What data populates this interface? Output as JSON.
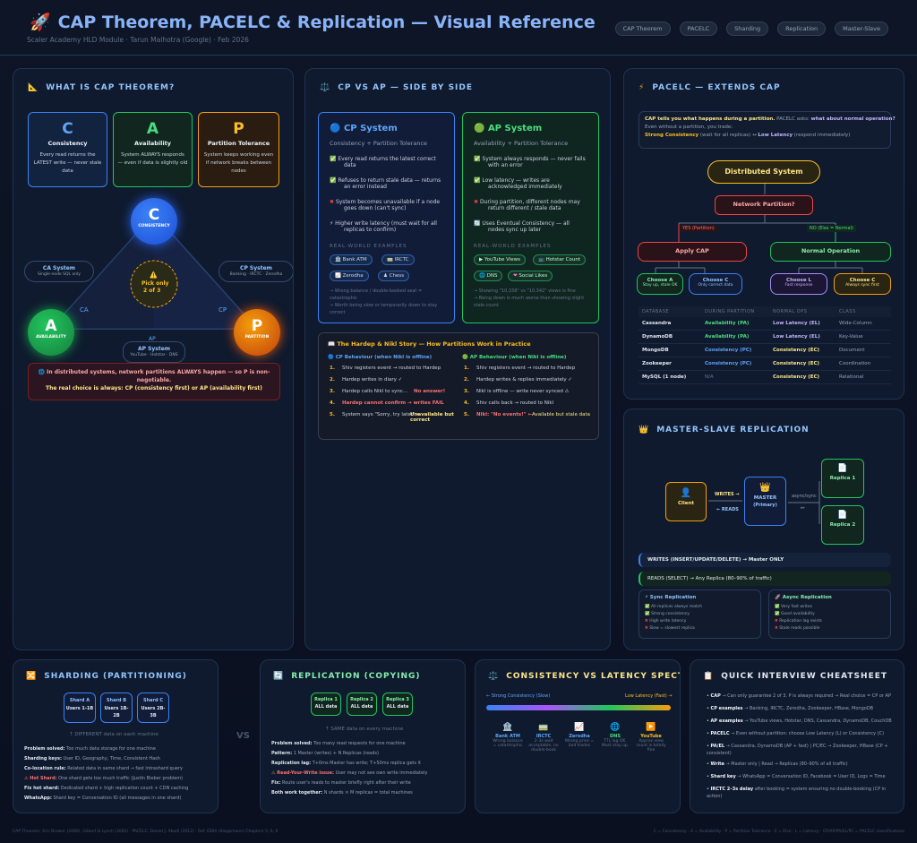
{
  "header": {
    "title": "CAP Theorem, PACELC & Replication — Visual Reference",
    "subtitle": "Scaler Academy HLD Module · Tarun Malhotra (Google) · Feb 2026",
    "tags": [
      "CAP Theorem",
      "PACELC",
      "Sharding",
      "Replication",
      "Master-Slave"
    ]
  },
  "cap": {
    "heading": "WHAT IS CAP THEOREM?",
    "c": {
      "letter": "C",
      "name": "Consistency",
      "d1": "Every read returns the",
      "d2": "LATEST write — never stale",
      "d3": "data"
    },
    "a": {
      "letter": "A",
      "name": "Availability",
      "d1": "System ALWAYS responds",
      "d2": "— even if data is slightly old"
    },
    "p": {
      "letter": "P",
      "name": "Partition Tolerance",
      "d1": "System keeps working even",
      "d2": "if network breaks between",
      "d3": "nodes"
    },
    "tri": {
      "c_label": "CONSISTENCY",
      "a_label": "AVAILABILITY",
      "p_label": "PARTITION",
      "center1": "Pick only",
      "center2": "2 of 3",
      "ca_edge": "CA",
      "cp_edge": "CP",
      "ap_edge": "AP"
    },
    "ca_sys": {
      "name": "CA System",
      "sub": "Single-node SQL only"
    },
    "cp_sys": {
      "name": "CP System",
      "sub": "Banking · IRCTC · Zerodha"
    },
    "ap_sys": {
      "name": "AP System",
      "sub": "YouTube · Hotstar · DNS"
    },
    "note1": "In distributed systems, network partitions ALWAYS happen — so P is non-",
    "note2": "negotiable.",
    "note3": "The real choice is always: CP (consistency first) or AP (availability first)"
  },
  "cpap": {
    "heading": "CP VS AP — SIDE BY SIDE",
    "cp": {
      "title": "CP System",
      "sub": "Consistency + Partition Tolerance",
      "items": [
        [
          "Every read returns the latest correct",
          "data"
        ],
        [
          "Refuses to return stale data — returns",
          "an error instead"
        ],
        [
          "System becomes unavailable if a node",
          "goes down (can't sync)"
        ],
        [
          "Higher write latency (must wait for all",
          "replicas to confirm)"
        ]
      ],
      "examples_label": "REAL-WORLD EXAMPLES",
      "examples": [
        "Bank ATM",
        "IRCTC",
        "Zerodha",
        "Chess"
      ],
      "foot": [
        "→ Wrong balance / double-booked seat =",
        "catastrophic",
        "→ Worth being slow or temporarily down to stay",
        "correct"
      ]
    },
    "ap": {
      "title": "AP System",
      "sub": "Availability + Partition Tolerance",
      "items": [
        [
          "System always responds — never fails",
          "with an error"
        ],
        [
          "Low latency — writes are",
          "acknowledged immediately"
        ],
        [
          "During partition, different nodes may",
          "return different / stale data"
        ],
        [
          "Uses Eventual Consistency — all",
          "nodes sync up later"
        ]
      ],
      "examples_label": "REAL-WORLD EXAMPLES",
      "examples": [
        "YouTube Views",
        "Hotstar Count",
        "DNS",
        "Social Likes"
      ],
      "foot": [
        "→ Showing \"10,338\" vs \"10,342\" views is fine",
        "→ Being down is much worse than showing slight",
        "stale count"
      ]
    },
    "story": {
      "title": "The Hardep & Nikl Story — How Partitions Work in Practice",
      "cp_head": "CP Behaviour (when Nikl is offline)",
      "ap_head": "AP Behaviour (when Nikl is offline)",
      "cp_rows": [
        [
          "1.",
          "Shiv registers event → routed to Hardep",
          ""
        ],
        [
          "2.",
          "Hardep writes in diary ✓",
          ""
        ],
        [
          "3.",
          "Hardep calls Nikl to sync...",
          "No answer!"
        ],
        [
          "4.",
          "Hardep cannot confirm → writes FAIL",
          ""
        ],
        [
          "5.",
          "System says \"Sorry, try later\" ←",
          "Unavailable but correct"
        ]
      ],
      "ap_rows": [
        [
          "1.",
          "Shiv registers event → routed to Hardep",
          ""
        ],
        [
          "2.",
          "Hardep writes & replies immediately ✓",
          ""
        ],
        [
          "3.",
          "Nikl is offline — write never synced ⚠",
          ""
        ],
        [
          "4.",
          "Shiv calls back → routed to Nikl",
          ""
        ],
        [
          "5.",
          "Nikl: \"No events!\" ←",
          "Available but stale data"
        ]
      ]
    }
  },
  "pacelc": {
    "heading": "PACELC — EXTENDS CAP",
    "intro1a": "CAP tells you what happens during a partition.",
    "intro1b": " PACELC asks: ",
    "intro1c": "what about normal operation?",
    "intro2": "Even without a partition, you trade:",
    "intro3a": "Strong Consistency",
    "intro3b": " (wait for all replicas) ",
    "intro3c": "Low Latency",
    "intro3d": " (respond immediately)",
    "ds": "Distributed System",
    "np": "Network Partition?",
    "yes": "YES (Partition)",
    "no": "NO (Else = Normal)",
    "apply_cap": "Apply CAP",
    "normal_ops": "Normal Operation",
    "ch": [
      {
        "t": "Choose A",
        "s": "Stay up, stale OK"
      },
      {
        "t": "Choose C",
        "s": "Only correct data"
      },
      {
        "t": "Choose L",
        "s": "Fast response"
      },
      {
        "t": "Choose C",
        "s": "Always sync first"
      }
    ],
    "table": {
      "cols": [
        "DATABASE",
        "DURING PARTITION",
        "NORMAL OPS",
        "CLASS"
      ],
      "rows": [
        [
          "Cassandra",
          "Availability (PA)",
          "Low Latency (EL)",
          "Wide-Column"
        ],
        [
          "DynamoDB",
          "Availability (PA)",
          "Low Latency (EL)",
          "Key-Value"
        ],
        [
          "MongoDB",
          "Consistency (PC)",
          "Consistency (EC)",
          "Document"
        ],
        [
          "Zookeeper",
          "Consistency (PC)",
          "Consistency (EC)",
          "Coordination"
        ],
        [
          "MySQL (1 node)",
          "N/A",
          "Consistency (EC)",
          "Relational"
        ]
      ]
    }
  },
  "ms": {
    "heading": "MASTER-SLAVE REPLICATION",
    "client": "Client",
    "writes": "WRITES →",
    "reads": "← READS",
    "master1": "MASTER",
    "master2": "(Primary)",
    "async": "async/sync",
    "r1": "Replica 1",
    "r2": "Replica 2",
    "w_bar": "WRITES (INSERT/UPDATE/DELETE) → Master ONLY",
    "r_bar": "READS (SELECT) → Any Replica (80–90% of traffic)",
    "sync": {
      "title": "Sync Replication",
      "items": [
        "All replicas always match",
        "Strong consistency",
        "High write latency",
        "Slow = slowest replica"
      ]
    },
    "async_r": {
      "title": "Async Replication",
      "items": [
        "Very fast writes",
        "Good availability",
        "Replication lag exists",
        "Stale reads possible"
      ]
    }
  },
  "shard": {
    "heading": "SHARDING (PARTITIONING)",
    "shards": [
      [
        "Shard A",
        "Users 1-1B"
      ],
      [
        "Shard B",
        "Users 1B-2B"
      ],
      [
        "Shard C",
        "Users 2B-3B"
      ]
    ],
    "caption": "↑ DIFFERENT data on each machine",
    "rows": [
      [
        "Problem solved:",
        "Too much data storage for one machine"
      ],
      [
        "Sharding keys:",
        "User ID, Geography, Time, Consistent Hash"
      ],
      [
        "Co-location rule:",
        "Related data in same shard → fast intrashard query"
      ],
      [
        "⚠ Hot Shard:",
        "One shard gets too much traffic (Justin Bieber problem)"
      ],
      [
        "Fix hot shard:",
        "Dedicated shard + high replication count + CDN caching"
      ],
      [
        "WhatsApp:",
        "Shard key = Conversation ID (all messages in one shard)"
      ]
    ]
  },
  "vs": "VS",
  "repl": {
    "heading": "REPLICATION (COPYING)",
    "reps": [
      [
        "Replica 1",
        "ALL data"
      ],
      [
        "Replica 2",
        "ALL data"
      ],
      [
        "Replica 3",
        "ALL data"
      ]
    ],
    "caption": "↑ SAME data on every machine",
    "rows": [
      [
        "Problem solved:",
        "Too many read requests for one machine"
      ],
      [
        "Pattern:",
        "1 Master (writes) + N Replicas (reads)"
      ],
      [
        "Replication lag:",
        "T+0ms Master has write; T+50ms replica gets it"
      ],
      [
        "⚠ Read-Your-Write issue:",
        "User may not see own write immediately"
      ],
      [
        "Fix:",
        "Route user's reads to master briefly right after their write"
      ],
      [
        "Both work together:",
        "N shards × M replicas = total machines"
      ]
    ]
  },
  "spec": {
    "heading": "CONSISTENCY VS LATENCY SPECTRUM",
    "left": "← Strong Consistency (Slow)",
    "right": "Low Latency (Fast) →",
    "items": [
      [
        "Bank ATM",
        "Wrong balance",
        "= catastrophic"
      ],
      [
        "IRCTC",
        "2–3s wait",
        "acceptable, no",
        "double-book"
      ],
      [
        "Zerodha",
        "Wrong price =",
        "bad trades"
      ],
      [
        "DNS",
        "TTL lag OK.",
        "Must stay up."
      ],
      [
        "YouTube",
        "Approx view",
        "count is totally",
        "fine"
      ]
    ]
  },
  "cheat": {
    "heading": "QUICK INTERVIEW CHEATSHEET",
    "rows": [
      [
        "CAP",
        "→ Can only guarantee 2 of 3. P is always required → Real choice = CP or AP"
      ],
      [
        "CP examples",
        "→ Banking, IRCTC, Zerodha, Zookeeper, HBase, MongoDB"
      ],
      [
        "AP examples",
        "→ YouTube views, Hotstar, DNS, Cassandra, DynamoDB, CouchDB"
      ],
      [
        "PACELC",
        "→ Even without partition: choose Low Latency (L) or Consistency (C)"
      ],
      [
        "PA/EL",
        "→ Cassandra, DynamoDB (AP + fast)  |  PC/EC → Zookeeper, HBase (CP + consistent)"
      ],
      [
        "Write",
        "→ Master only  |  Read → Replicas (80–90% of all traffic)"
      ],
      [
        "Shard key",
        "→ WhatsApp = Conversation ID, Facebook = User ID, Logs = Time"
      ],
      [
        "IRCTC 2–3s delay",
        "after booking = system ensuring no double-booking (CP in action)"
      ]
    ]
  },
  "footer": {
    "left": "CAP Theorem: Eric Brewer (2000), Gilbert & Lynch (2002) · PACELC: Daniel J. Abadi (2012) · Ref: DDIA (Kleppmann) Chapters 5, 6, 9",
    "right": "C = Consistency · A = Availability · P = Partition Tolerance · E = Else · L = Latency · CP/AP/PA/EL/PC = PACELC classifications"
  }
}
